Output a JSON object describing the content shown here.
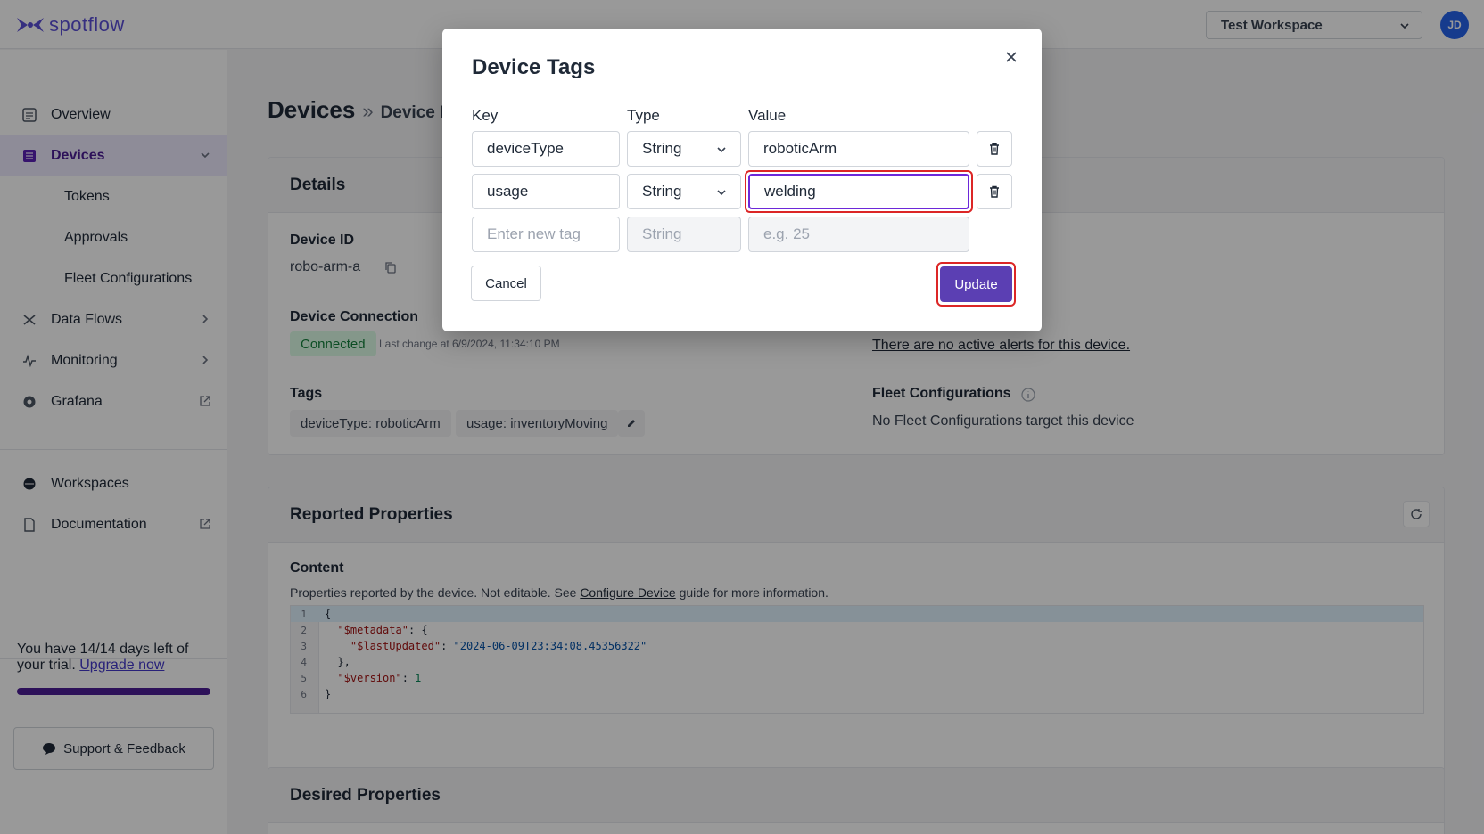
{
  "topbar": {
    "logo_text": "spotflow",
    "workspace_selected": "Test Workspace",
    "avatar_initials": "JD",
    "brand_color": "#5b4fd6"
  },
  "sidebar": {
    "items": [
      {
        "label": "Overview",
        "icon": "overview-icon"
      },
      {
        "label": "Devices",
        "icon": "devices-icon",
        "active": true
      },
      {
        "label": "Data Flows",
        "icon": "data-flows-icon"
      },
      {
        "label": "Monitoring",
        "icon": "monitoring-icon"
      },
      {
        "label": "Grafana",
        "icon": "grafana-icon"
      },
      {
        "label": "Workspaces",
        "icon": "workspaces-icon"
      },
      {
        "label": "Documentation",
        "icon": "documentation-icon"
      }
    ],
    "device_subitems": [
      "Tokens",
      "Approvals",
      "Fleet Configurations"
    ],
    "trial_text": "You have 14/14 days left of your trial.",
    "trial_link": "Upgrade now",
    "trial_progress": 1.0,
    "support_label": "Support & Feedback"
  },
  "main": {
    "breadcrumb_title": "Devices",
    "breadcrumb_sep": "»",
    "breadcrumb_sub": "Device D",
    "details": {
      "header": "Details",
      "device_id_label": "Device ID",
      "device_id_value": "robo-arm-a",
      "connection_label": "Device Connection",
      "connection_status": "Connected",
      "last_change": "Last change at 6/9/2024, 11:34:10 PM",
      "alerts_text": "There are no active alerts for this device.",
      "tags_label": "Tags",
      "tags": [
        "deviceType: roboticArm",
        "usage: inventoryMoving"
      ],
      "fleet_label": "Fleet Configurations",
      "fleet_value": "No Fleet Configurations target this device"
    },
    "reported": {
      "header": "Reported Properties",
      "content_label": "Content",
      "desc_prefix": "Properties reported by the device. Not editable. See ",
      "desc_link": "Configure Device",
      "desc_suffix": " guide for more information.",
      "code": {
        "line1": "{",
        "line2_key": "\"$metadata\"",
        "line2_rest": ": {",
        "line3_key": "\"$lastUpdated\"",
        "line3_sep": ": ",
        "line3_val": "\"2024-06-09T23:34:08.45356322\"",
        "line4": "},",
        "line5_key": "\"$version\"",
        "line5_sep": ": ",
        "line5_val": "1",
        "line6": "}"
      }
    },
    "desired": {
      "header": "Desired Properties"
    }
  },
  "modal": {
    "title": "Device Tags",
    "col_key": "Key",
    "col_type": "Type",
    "col_value": "Value",
    "rows": [
      {
        "key": "deviceType",
        "type": "String",
        "value": "roboticArm"
      },
      {
        "key": "usage",
        "type": "String",
        "value": "welding"
      }
    ],
    "new_row": {
      "key_placeholder": "Enter new tag",
      "type_placeholder": "String",
      "value_placeholder": "e.g. 25"
    },
    "cancel_label": "Cancel",
    "update_label": "Update",
    "accent_color": "#5b3fb3",
    "highlight_color": "#dc2626"
  }
}
